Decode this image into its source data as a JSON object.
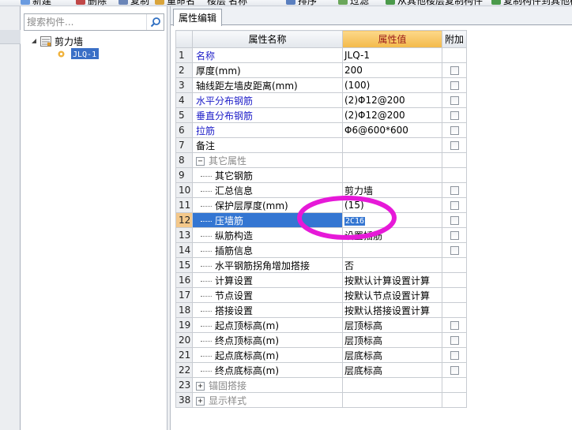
{
  "toolbar": {
    "items": [
      "新建",
      "删除",
      "复制",
      "重命名",
      "楼层",
      "名称",
      "排序",
      "过滤",
      "从其他楼层复制构件",
      "复制构件到其他楼层"
    ]
  },
  "search": {
    "placeholder": "搜索构件..."
  },
  "tree": {
    "root_label": "剪力墙",
    "child_label": "JLQ-1"
  },
  "tab": {
    "label": "属性编辑"
  },
  "grid": {
    "headers": {
      "name": "属性名称",
      "value": "属性值",
      "extra": "附加"
    },
    "rows": [
      {
        "num": "1",
        "name": "名称",
        "value": "JLQ-1",
        "check": false,
        "style": "blue"
      },
      {
        "num": "2",
        "name": "厚度(mm)",
        "value": "200",
        "check": true
      },
      {
        "num": "3",
        "name": "轴线距左墙皮距离(mm)",
        "value": "(100)",
        "check": true
      },
      {
        "num": "4",
        "name": "水平分布钢筋",
        "value": "(2)Φ12@200",
        "check": true,
        "style": "blue"
      },
      {
        "num": "5",
        "name": "垂直分布钢筋",
        "value": "(2)Φ12@200",
        "check": true,
        "style": "blue"
      },
      {
        "num": "6",
        "name": "拉筋",
        "value": "Φ6@600*600",
        "check": true,
        "style": "blue"
      },
      {
        "num": "7",
        "name": "备注",
        "value": "",
        "check": true
      },
      {
        "num": "8",
        "name": "其它属性",
        "value": "",
        "check": false,
        "group": "−"
      },
      {
        "num": "9",
        "name": "其它钢筋",
        "value": "",
        "check": false,
        "child": true
      },
      {
        "num": "10",
        "name": "汇总信息",
        "value": "剪力墙",
        "check": true,
        "child": true
      },
      {
        "num": "11",
        "name": "保护层厚度(mm)",
        "value": "(15)",
        "check": true,
        "child": true
      },
      {
        "num": "12",
        "name": "压墙筋",
        "value": "2C16",
        "check": true,
        "child": true,
        "selected": true
      },
      {
        "num": "13",
        "name": "纵筋构造",
        "value": "设置插筋",
        "check": true,
        "child": true
      },
      {
        "num": "14",
        "name": "插筋信息",
        "value": "",
        "check": true,
        "child": true
      },
      {
        "num": "15",
        "name": "水平钢筋拐角增加搭接",
        "value": "否",
        "check": false,
        "child": true
      },
      {
        "num": "16",
        "name": "计算设置",
        "value": "按默认计算设置计算",
        "check": false,
        "child": true
      },
      {
        "num": "17",
        "name": "节点设置",
        "value": "按默认节点设置计算",
        "check": false,
        "child": true
      },
      {
        "num": "18",
        "name": "搭接设置",
        "value": "按默认搭接设置计算",
        "check": false,
        "child": true
      },
      {
        "num": "19",
        "name": "起点顶标高(m)",
        "value": "层顶标高",
        "check": true,
        "child": true
      },
      {
        "num": "20",
        "name": "终点顶标高(m)",
        "value": "层顶标高",
        "check": true,
        "child": true
      },
      {
        "num": "21",
        "name": "起点底标高(m)",
        "value": "层底标高",
        "check": true,
        "child": true
      },
      {
        "num": "22",
        "name": "终点底标高(m)",
        "value": "层底标高",
        "check": true,
        "child": true
      },
      {
        "num": "23",
        "name": "锚固搭接",
        "value": "",
        "check": false,
        "group": "+"
      },
      {
        "num": "38",
        "name": "显示样式",
        "value": "",
        "check": false,
        "group": "+"
      }
    ]
  },
  "colors": {
    "selection": "#3476d2",
    "value_header": "#f3b94a",
    "annotation": "#e619d8"
  }
}
